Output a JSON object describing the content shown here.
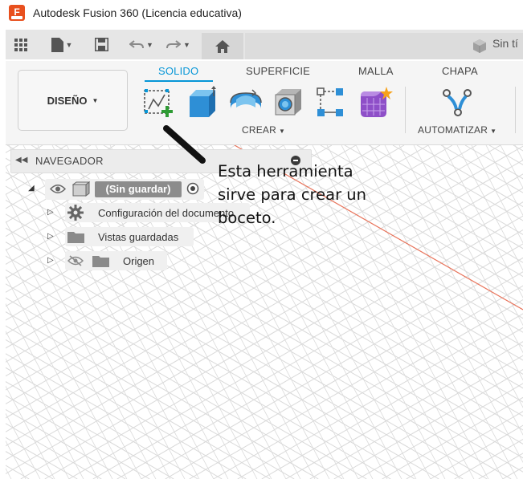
{
  "window": {
    "title": "Autodesk Fusion 360 (Licencia educativa)",
    "app_logo_letter": "F"
  },
  "quick_access": {
    "document_tab_label": "Sin tí"
  },
  "ribbon": {
    "workspace_label": "DISEÑO",
    "tabs": [
      {
        "label": "SOLIDO",
        "active": true
      },
      {
        "label": "SUPERFICIE",
        "active": false
      },
      {
        "label": "MALLA",
        "active": false
      },
      {
        "label": "CHAPA",
        "active": false
      }
    ],
    "groups": {
      "create_label": "CREAR",
      "automate_label": "AUTOMATIZAR"
    }
  },
  "browser": {
    "title": "NAVEGADOR",
    "root_label": "(Sin guardar)",
    "items": [
      {
        "label": "Configuración del documento",
        "icon": "gear-icon"
      },
      {
        "label": "Vistas guardadas",
        "icon": "folder-icon"
      },
      {
        "label": "Origen",
        "icon": "folder-icon"
      }
    ]
  },
  "annotation": {
    "lines": [
      "Esta herramienta",
      "sirve para crear un",
      "boceto."
    ]
  },
  "colors": {
    "accent": "#0696d7",
    "app_logo": "#e8501e",
    "grid_line": "#d9d9d9",
    "axis_red": "#e8735a"
  }
}
